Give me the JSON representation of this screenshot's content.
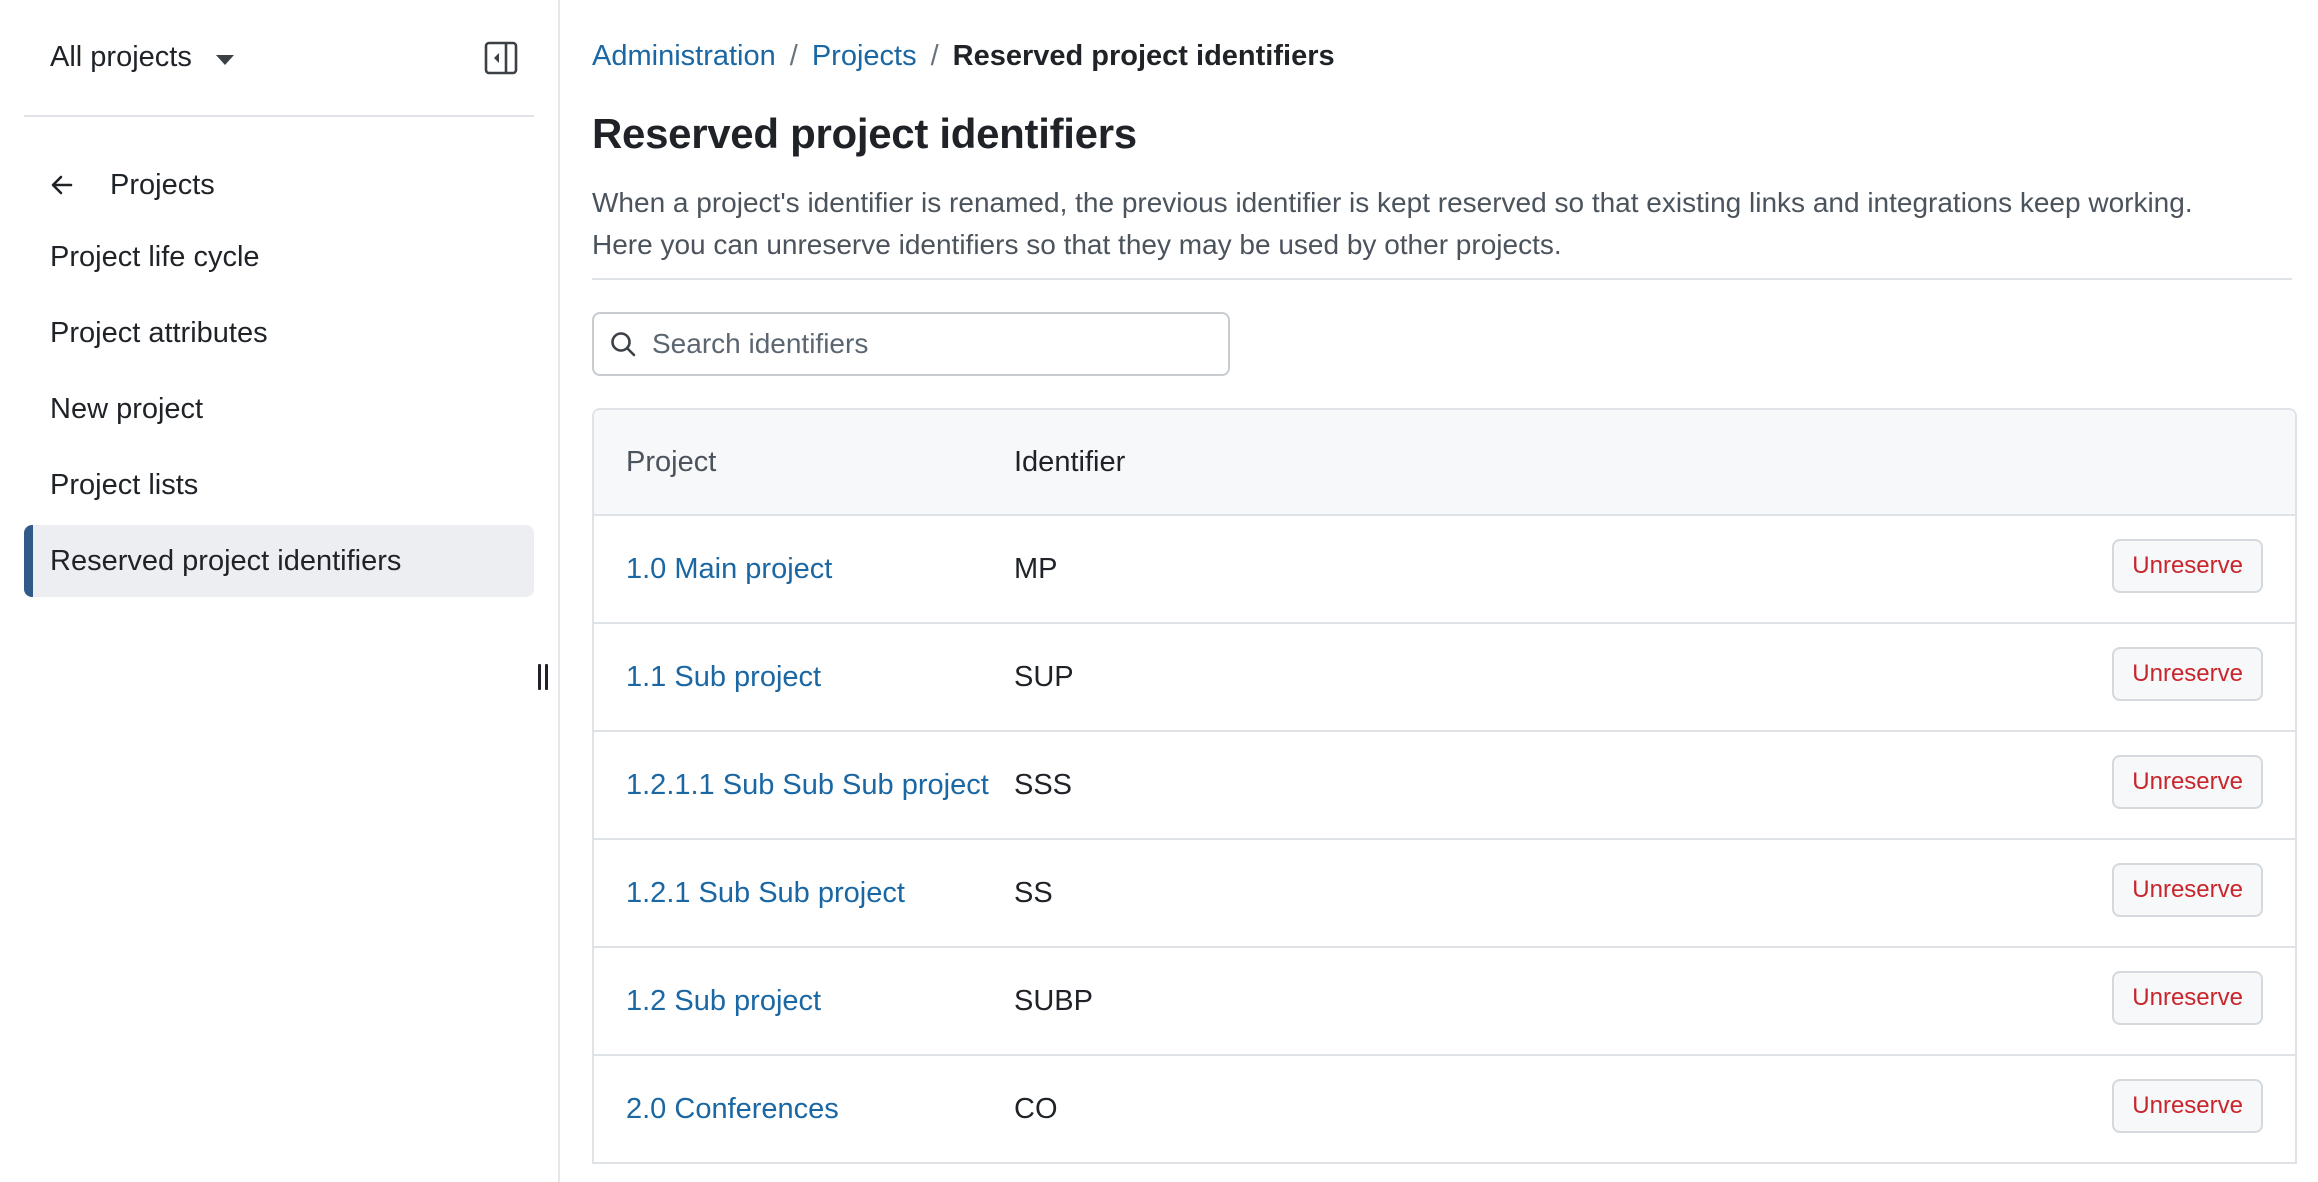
{
  "sidebar": {
    "project_select": "All projects",
    "back_label": "Projects",
    "items": [
      {
        "label": "Project life cycle",
        "active": false
      },
      {
        "label": "Project attributes",
        "active": false
      },
      {
        "label": "New project",
        "active": false
      },
      {
        "label": "Project lists",
        "active": false
      },
      {
        "label": "Reserved project identifiers",
        "active": true
      }
    ]
  },
  "breadcrumb": {
    "items": [
      "Administration",
      "Projects"
    ],
    "separator": "/",
    "current": "Reserved project identifiers"
  },
  "page": {
    "title": "Reserved project identifiers",
    "description_line1": "When a project's identifier is renamed, the previous identifier is kept reserved so that existing links and integrations keep working.",
    "description_line2": "Here you can unreserve identifiers so that they may be used by other projects."
  },
  "search": {
    "placeholder": "Search identifiers",
    "value": ""
  },
  "table": {
    "headers": {
      "project": "Project",
      "identifier": "Identifier"
    },
    "action_label": "Unreserve",
    "rows": [
      {
        "project": "1.0 Main project",
        "identifier": "MP"
      },
      {
        "project": "1.1 Sub project",
        "identifier": "SUP"
      },
      {
        "project": "1.2.1.1 Sub Sub Sub project",
        "identifier": "SSS"
      },
      {
        "project": "1.2.1 Sub Sub project",
        "identifier": "SS"
      },
      {
        "project": "1.2 Sub project",
        "identifier": "SUBP"
      },
      {
        "project": "2.0 Conferences",
        "identifier": "CO"
      }
    ]
  },
  "colors": {
    "link": "#1a67a3",
    "danger": "#c9252c",
    "active_marker": "#2f5a8a"
  },
  "icons": {
    "back": "arrow-left-icon",
    "collapse": "sidebar-collapse-icon",
    "search": "search-icon",
    "dropdown": "caret-down-icon"
  }
}
